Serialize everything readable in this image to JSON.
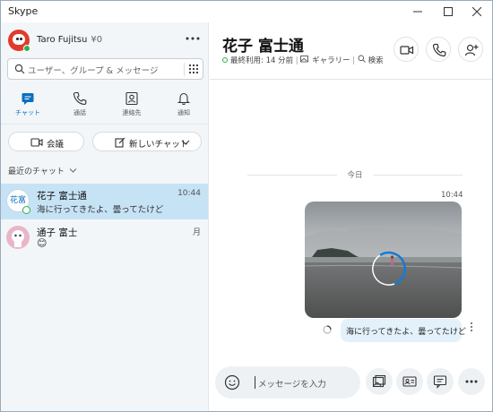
{
  "window": {
    "title": "Skype"
  },
  "profile": {
    "name": "Taro Fujitsu",
    "credit": "¥0"
  },
  "search": {
    "placeholder": "ユーザー、グループ & メッセージ"
  },
  "tabs": [
    {
      "label": "チャット",
      "icon": "chat-icon",
      "active": true
    },
    {
      "label": "通話",
      "icon": "phone-icon",
      "active": false
    },
    {
      "label": "連絡先",
      "icon": "contacts-icon",
      "active": false
    },
    {
      "label": "通知",
      "icon": "bell-icon",
      "active": false
    }
  ],
  "actions": {
    "meeting": "会議",
    "new_chat": "新しいチャット"
  },
  "recent_label": "最近のチャット",
  "chats": [
    {
      "name": "花子 富士通",
      "time": "10:44",
      "preview": "海に行ってきたよ、曇ってたけど",
      "avatar_text": "花富",
      "selected": true
    },
    {
      "name": "通子 富士",
      "time": "月",
      "preview": "😊",
      "selected": false
    }
  ],
  "conversation": {
    "title": "花子 富士通",
    "last_seen_label": "最終利用: 14 分前",
    "gallery_label": "ギャラリー",
    "find_label": "検索",
    "date_divider": "今日",
    "message_time": "10:44",
    "message_text": "海に行ってきたよ、曇ってたけど"
  },
  "composer": {
    "placeholder": "メッセージを入力"
  },
  "colors": {
    "accent": "#0a6fc2",
    "selected": "#c6e3f6",
    "bubble": "#e3f1fb",
    "online": "#29b34a"
  }
}
